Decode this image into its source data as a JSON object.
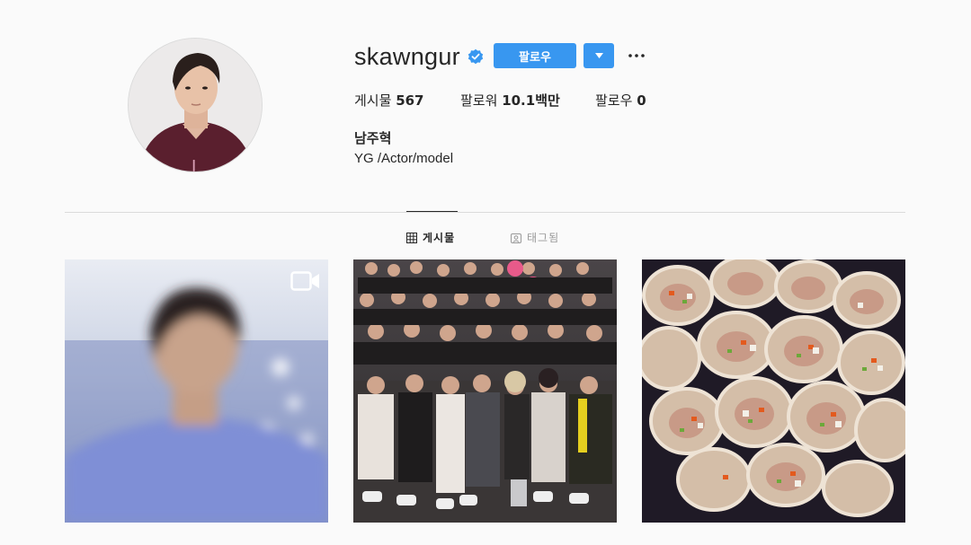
{
  "profile": {
    "username": "skawngur",
    "verified": true,
    "follow_label": "팔로우",
    "dropdown_icon": "caret-down-icon",
    "more_icon": "more-horizontal-icon",
    "stats": {
      "posts_label": "게시물",
      "posts_count": "567",
      "followers_label": "팔로워",
      "followers_count": "10.1백만",
      "following_label": "팔로우",
      "following_count": "0"
    },
    "full_name": "남주혁",
    "bio": "YG /Actor/model"
  },
  "tabs": [
    {
      "label": "게시물",
      "icon": "grid-icon",
      "active": true
    },
    {
      "label": "태그됨",
      "icon": "tagged-icon",
      "active": false
    }
  ],
  "posts": [
    {
      "type": "video",
      "icon": "video-icon"
    },
    {
      "type": "photo"
    },
    {
      "type": "photo"
    }
  ],
  "colors": {
    "accent": "#3897f0",
    "background": "#fafafa",
    "text": "#262626",
    "muted": "#999999",
    "divider": "#dbdbdb"
  }
}
